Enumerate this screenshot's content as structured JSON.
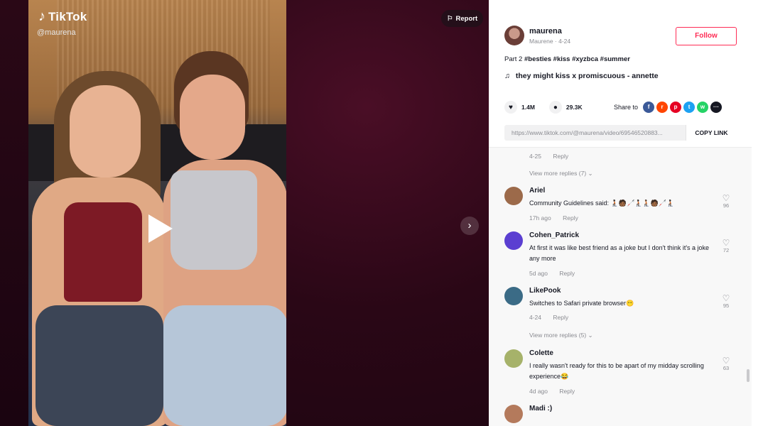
{
  "video": {
    "logo_text": "TikTok",
    "handle": "@maurena",
    "report_label": "Report"
  },
  "author": {
    "name": "maurena",
    "sub": "Maurene · 4-24",
    "follow_label": "Follow"
  },
  "caption": {
    "prefix": "Part 2",
    "tags": "#besties #kiss #xyzbca #summer"
  },
  "music": "they might kiss x promiscuous - annette",
  "stats": {
    "likes": "1.4M",
    "comments": "29.3K"
  },
  "share": {
    "label": "Share to",
    "targets": [
      {
        "name": "facebook",
        "glyph": "f",
        "color": "#3b5998"
      },
      {
        "name": "reddit",
        "glyph": "r",
        "color": "#ff4500"
      },
      {
        "name": "pinterest",
        "glyph": "p",
        "color": "#e60023"
      },
      {
        "name": "twitter",
        "glyph": "t",
        "color": "#1da1f2"
      },
      {
        "name": "whatsapp",
        "glyph": "w",
        "color": "#25d366"
      },
      {
        "name": "more",
        "glyph": "···",
        "color": "#161823"
      }
    ]
  },
  "link": {
    "url": "https://www.tiktok.com/@maurena/video/69546520883...",
    "copy_label": "COPY LINK"
  },
  "comments_top": {
    "date": "4-25",
    "reply": "Reply",
    "more_replies": "View more replies (7)"
  },
  "comments": [
    {
      "name": "Ariel",
      "text": "Community Guidelines said: 🧎🏿🧑🏾🦯🧎🏿🧎🏾🧑🏾🦯🧎🏿",
      "date": "17h ago",
      "reply": "Reply",
      "likes": "96",
      "avatar_color": "#9c6a4a"
    },
    {
      "name": "Cohen_Patrick",
      "text": "At first it was like best friend as a joke but I don't think it's a joke any more",
      "date": "5d ago",
      "reply": "Reply",
      "likes": "72",
      "avatar_color": "#5b3fd1"
    },
    {
      "name": "LikePook",
      "text": "Switches to Safari private browser😶",
      "date": "4-24",
      "reply": "Reply",
      "likes": "95",
      "avatar_color": "#3b6b86"
    },
    {
      "name": "Colette",
      "text": "I really wasn't ready for this to be apart of my midday scrolling experience😂",
      "date": "4d ago",
      "reply": "Reply",
      "likes": "63",
      "avatar_color": "#a6b26a"
    },
    {
      "name": "Madi :)",
      "text": "",
      "date": "",
      "reply": "",
      "likes": "",
      "avatar_color": "#b47a5c"
    }
  ],
  "lp_more_replies": "View more replies (5)"
}
